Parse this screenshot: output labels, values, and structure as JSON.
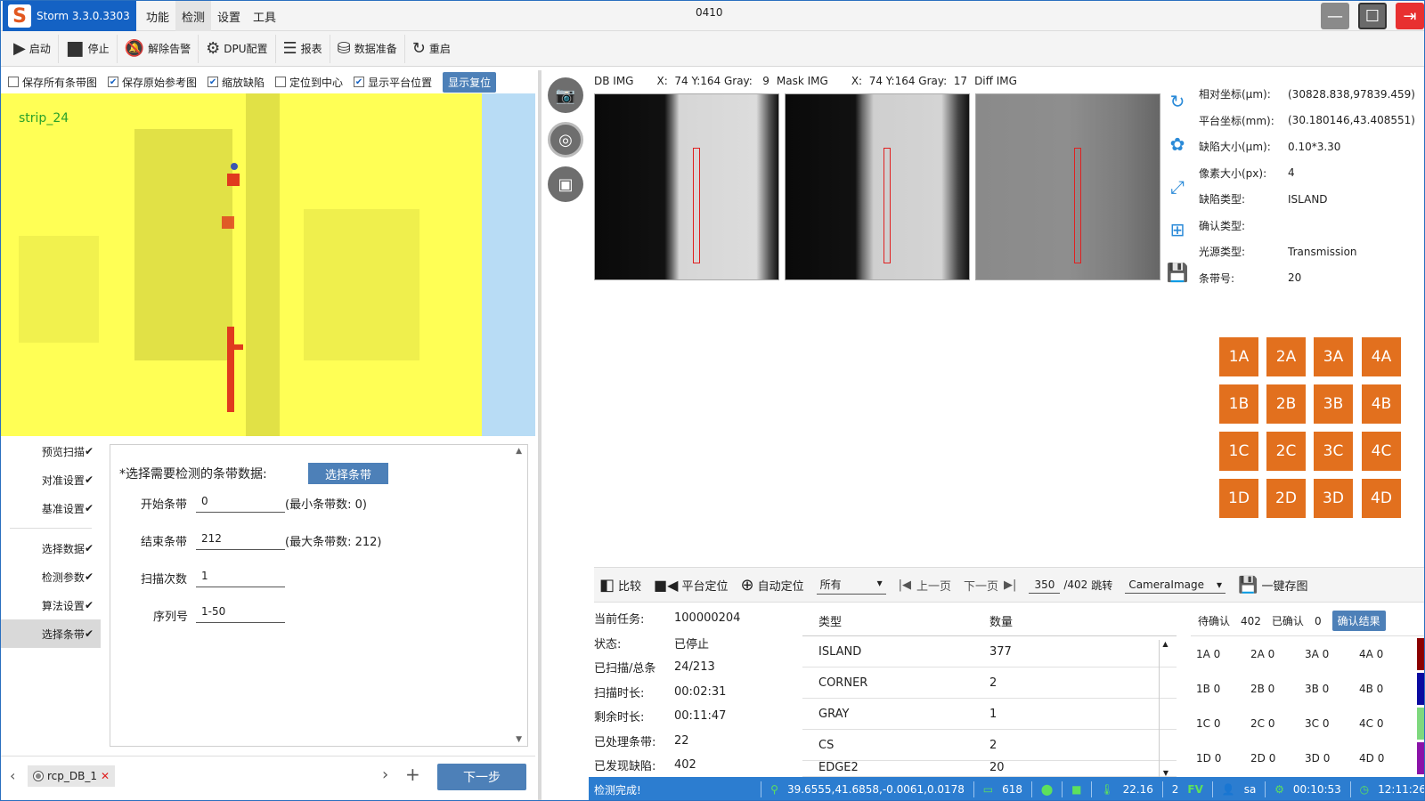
{
  "app": {
    "name": "Storm 3.3.0.3303",
    "logo_letter": "S",
    "window_title": "0410"
  },
  "menu": [
    "功能",
    "检测",
    "设置",
    "工具"
  ],
  "toolbar": [
    {
      "label": "启动",
      "icon": "play-icon"
    },
    {
      "label": "停止",
      "icon": "stop-icon"
    },
    {
      "label": "解除告警",
      "icon": "bell-off-icon"
    },
    {
      "label": "DPU配置",
      "icon": "gear-icon"
    },
    {
      "label": "报表",
      "icon": "report-icon"
    },
    {
      "label": "数据准备",
      "icon": "database-icon"
    },
    {
      "label": "重启",
      "icon": "restart-icon"
    }
  ],
  "options": [
    {
      "label": "保存所有条带图",
      "checked": false
    },
    {
      "label": "保存原始参考图",
      "checked": true
    },
    {
      "label": "缩放缺陷",
      "checked": true
    },
    {
      "label": "定位到中心",
      "checked": false
    },
    {
      "label": "显示平台位置",
      "checked": true
    }
  ],
  "reset_label": "显示复位",
  "strip_label": "strip_24",
  "steps": [
    {
      "label": "预览扫描",
      "done": "✔"
    },
    {
      "label": "对准设置",
      "done": "✔"
    },
    {
      "label": "基准设置",
      "done": "✔"
    },
    {
      "label": "选择数据",
      "done": "✔"
    },
    {
      "label": "检测参数",
      "done": "✔"
    },
    {
      "label": "算法设置",
      "done": "✔"
    },
    {
      "label": "选择条带",
      "done": "✔"
    }
  ],
  "form": {
    "prompt": "*选择需要检测的条带数据:",
    "select_btn": "选择条带",
    "start_label": "开始条带",
    "start_value": "0",
    "start_hint": "(最小条带数: 0)",
    "end_label": "结束条带",
    "end_value": "212",
    "end_hint": "(最大条带数: 212)",
    "scan_label": "扫描次数",
    "scan_value": "1",
    "serial_label": "序列号",
    "serial_value": "1-50"
  },
  "recipe_tag": "rcp_DB_1",
  "next_btn": "下一步",
  "img_header": {
    "db": "DB IMG",
    "db_info": "X:  74 Y:164 Gray:   9",
    "mask": "Mask IMG",
    "mask_info": "X:  74 Y:164 Gray:  17",
    "diff": "Diff IMG"
  },
  "info": [
    {
      "k": "相对坐标(μm):",
      "v": "(30828.838,97839.459)"
    },
    {
      "k": "平台坐标(mm):",
      "v": "(30.180146,43.408551)"
    },
    {
      "k": "缺陷大小(μm):",
      "v": "0.10*3.30"
    },
    {
      "k": "像素大小(px):",
      "v": "4"
    },
    {
      "k": "缺陷类型:",
      "v": "ISLAND"
    },
    {
      "k": "确认类型:",
      "v": ""
    },
    {
      "k": "光源类型:",
      "v": "Transmission"
    },
    {
      "k": "条带号:",
      "v": "20"
    }
  ],
  "grid_buttons": [
    "1A",
    "2A",
    "3A",
    "4A",
    "1B",
    "2B",
    "3B",
    "4B",
    "1C",
    "2C",
    "3C",
    "4C",
    "1D",
    "2D",
    "3D",
    "4D"
  ],
  "defect_toolbar": {
    "compare": "比较",
    "stage_pos": "平台定位",
    "auto_pos": "自动定位",
    "filter": "所有",
    "prev": "上一页",
    "next": "下一页",
    "page": "350",
    "total": "/402",
    "jump": "跳转",
    "image_type": "CameraImage",
    "save_all": "一键存图"
  },
  "status": [
    {
      "k": "当前任务:",
      "v": "100000204"
    },
    {
      "k": "状态:",
      "v": "已停止"
    },
    {
      "k": "已扫描/总条",
      "v": "24/213"
    },
    {
      "k": "扫描时长:",
      "v": "00:02:31"
    },
    {
      "k": "剩余时长:",
      "v": "00:11:47"
    },
    {
      "k": "已处理条带:",
      "v": "22"
    },
    {
      "k": "已发现缺陷:",
      "v": "402"
    }
  ],
  "type_table": {
    "headers": [
      "类型",
      "数量"
    ],
    "rows": [
      [
        "ISLAND",
        "377"
      ],
      [
        "CORNER",
        "2"
      ],
      [
        "GRAY",
        "1"
      ],
      [
        "CS",
        "2"
      ],
      [
        "EDGE2",
        "20"
      ]
    ]
  },
  "confirm": {
    "pending_label": "待确认",
    "pending": "402",
    "confirmed_label": "已确认",
    "confirmed": "0",
    "btn": "确认结果",
    "rows": [
      {
        "cells": [
          "1A 0",
          "2A 0",
          "3A 0",
          "4A 0"
        ],
        "color": "#8b0000"
      },
      {
        "cells": [
          "1B 0",
          "2B 0",
          "3B 0",
          "4B 0"
        ],
        "color": "#0a0aa0"
      },
      {
        "cells": [
          "1C 0",
          "2C 0",
          "3C 0",
          "4C 0"
        ],
        "color": "#7ed87e"
      },
      {
        "cells": [
          "1D 0",
          "2D 0",
          "3D 0",
          "4D 0"
        ],
        "color": "#8a12a8"
      }
    ]
  },
  "statusbar": {
    "msg": "检测完成!",
    "coords": "39.6555,41.6858,-0.0061,0.0178",
    "count": "618",
    "temp": "22.16",
    "fv_num": "2",
    "fv": "FV",
    "user": "sa",
    "elapsed": "00:10:53",
    "clock": "12:11:26"
  },
  "colors": {
    "accent": "#4d80b8",
    "brand": "#1462c4",
    "orange": "#e2701e"
  }
}
